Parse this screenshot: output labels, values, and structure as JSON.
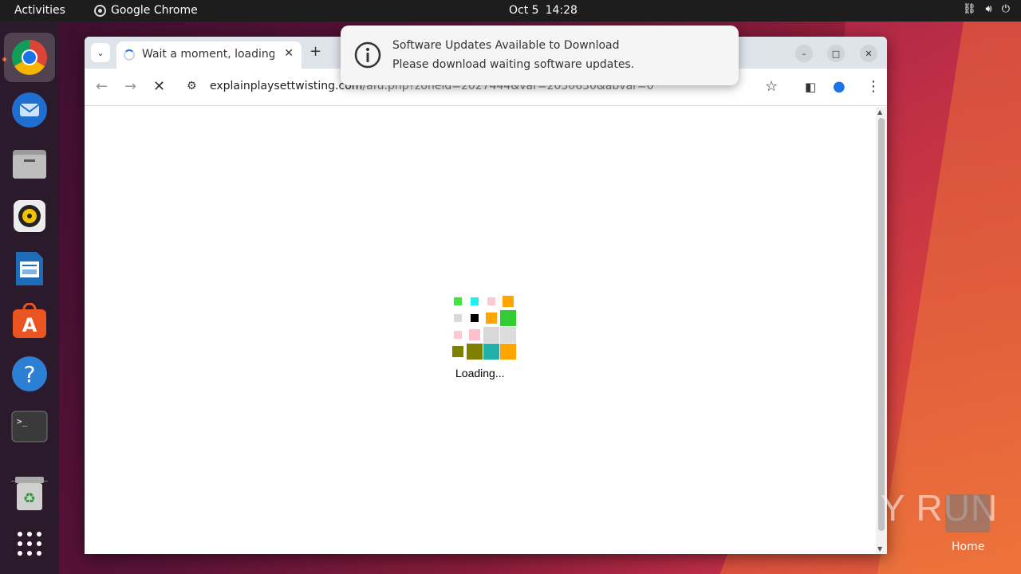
{
  "topbar": {
    "activities": "Activities",
    "app_name": "Google Chrome",
    "date": "Oct 5",
    "time": "14:28"
  },
  "dock": {
    "items": [
      "chrome-icon",
      "thunderbird-icon",
      "files-icon",
      "rhythmbox-icon",
      "writer-icon",
      "app-center-icon",
      "help-icon",
      "terminal-icon",
      "trash-icon",
      "app-grid-icon"
    ]
  },
  "browser": {
    "tab_title": "Wait a moment, loading",
    "url_domain": "explainplaysettwisting.com",
    "url_path": "/afu.php?zoneid=2027444&var=2030630&abvar=0"
  },
  "page": {
    "loading_text": "Loading...",
    "loader_colors": [
      "#3ee63e",
      "#19f0f0",
      "#ffc8d2",
      "#ffa500",
      "#d8d8e0",
      "#000000",
      "#ffa500",
      "#32cd32",
      "#ffc8d2",
      "#ffc0cb",
      "#d8d8d8",
      "#dcdcdc",
      "#808000",
      "#808000",
      "#20b2aa",
      "#ffa500"
    ]
  },
  "notification": {
    "title": "Software Updates Available to Download",
    "body": "Please download waiting software updates."
  },
  "desktop": {
    "watermark": "ANY RUN",
    "home_label": "Home"
  },
  "colors": {
    "accent": "#e95420",
    "chrome_blue": "#1a73e8"
  }
}
